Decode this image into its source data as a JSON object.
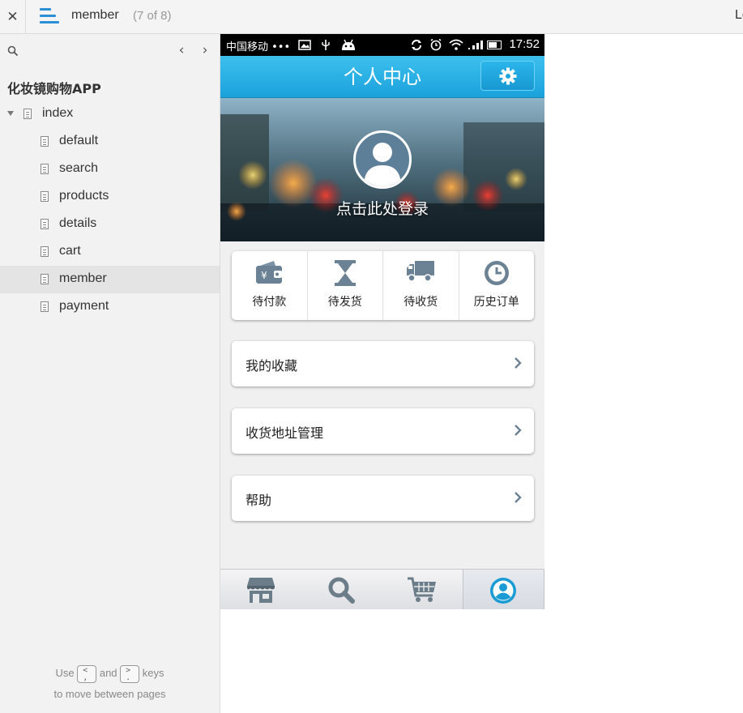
{
  "topbar": {
    "close_glyph": "✕",
    "page_name": "member",
    "page_count": "(7 of 8)",
    "right_text": "Lo"
  },
  "sidebar": {
    "prev_glyph": "‹",
    "next_glyph": "›",
    "project_title": "化妆镜购物APP",
    "pages": [
      {
        "label": "index",
        "level": 0
      },
      {
        "label": "default",
        "level": 1
      },
      {
        "label": "search",
        "level": 1
      },
      {
        "label": "products",
        "level": 1
      },
      {
        "label": "details",
        "level": 1
      },
      {
        "label": "cart",
        "level": 1
      },
      {
        "label": "member",
        "level": 1,
        "active": true
      },
      {
        "label": "payment",
        "level": 1
      }
    ],
    "hint": {
      "use": "Use",
      "key_prev": "<",
      "and": "and",
      "key_next": ">",
      "keys": "keys",
      "line2": "to move between pages"
    }
  },
  "phone": {
    "status": {
      "carrier": "中国移动 •••",
      "time": "17:52"
    },
    "app_title": "个人中心",
    "login_text": "点击此处登录",
    "orders": [
      {
        "label": "待付款",
        "icon": "wallet-icon"
      },
      {
        "label": "待发货",
        "icon": "hourglass-icon"
      },
      {
        "label": "待收货",
        "icon": "truck-icon"
      },
      {
        "label": "历史订单",
        "icon": "clock-icon"
      }
    ],
    "rows": [
      {
        "label": "我的收藏"
      },
      {
        "label": "收货地址管理"
      },
      {
        "label": "帮助"
      }
    ],
    "tabs": [
      {
        "icon": "store-icon"
      },
      {
        "icon": "search-icon"
      },
      {
        "icon": "cart-icon"
      },
      {
        "icon": "user-icon",
        "active": true
      }
    ]
  },
  "colors": {
    "accent_blue": "#2b8fd6",
    "appbar_blue": "#1aa2dc",
    "icon_gray": "#6b8294"
  }
}
